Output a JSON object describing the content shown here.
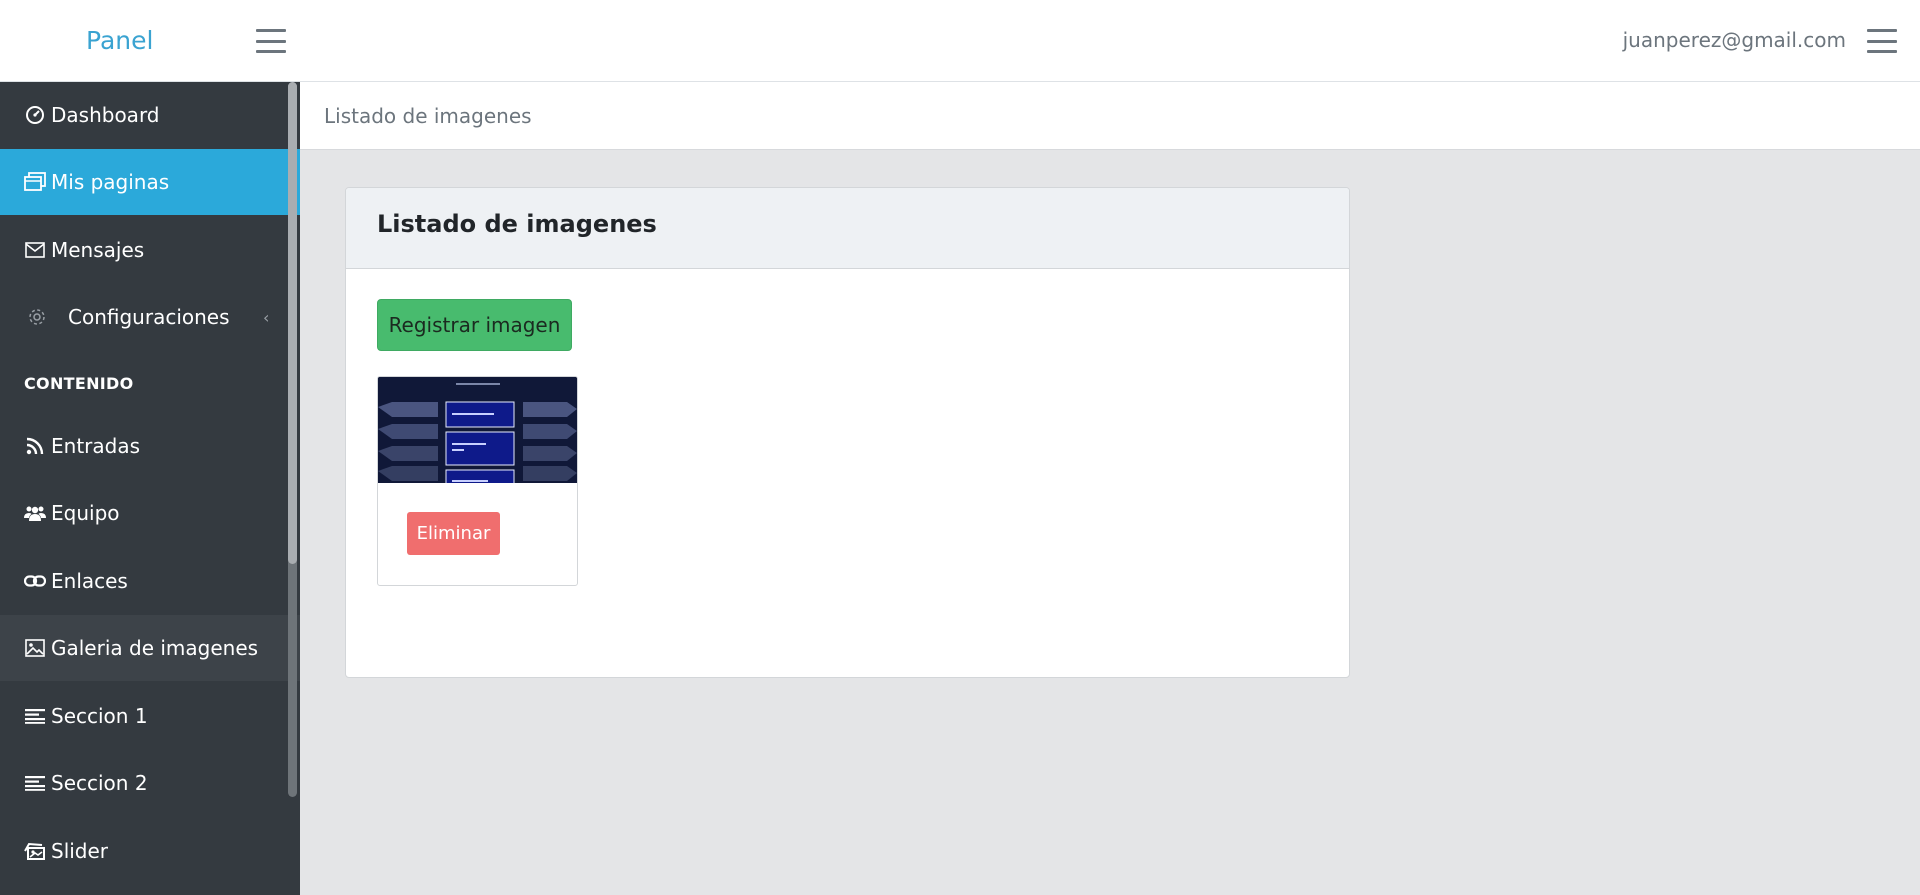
{
  "header": {
    "brand": "Panel",
    "user_email": "juanperez@gmail.com"
  },
  "sidebar": {
    "items": [
      {
        "label": "Dashboard",
        "icon": "dashboard-icon"
      },
      {
        "label": "Mis paginas",
        "icon": "pages-icon"
      },
      {
        "label": "Mensajes",
        "icon": "envelope-icon"
      },
      {
        "label": "Configuraciones",
        "icon": "gear-icon"
      },
      {
        "label": "Entradas",
        "icon": "rss-icon"
      },
      {
        "label": "Equipo",
        "icon": "users-icon"
      },
      {
        "label": "Enlaces",
        "icon": "link-icon"
      },
      {
        "label": "Galeria de imagenes",
        "icon": "image-icon"
      },
      {
        "label": "Seccion 1",
        "icon": "list-icon"
      },
      {
        "label": "Seccion 2",
        "icon": "list-icon"
      },
      {
        "label": "Slider",
        "icon": "slider-icon"
      }
    ],
    "section_header": "CONTENIDO",
    "active_item": "Mis paginas",
    "colors": {
      "background": "#343a40",
      "active": "#2ba9da"
    }
  },
  "breadcrumb": {
    "current": "Listado de imagenes"
  },
  "main": {
    "card_title": "Listado de imagenes",
    "register_button": "Registrar imagen",
    "images": [
      {
        "delete_label": "Eliminar"
      }
    ],
    "colors": {
      "register": "#48bb6e",
      "delete": "#f06e6e"
    }
  }
}
